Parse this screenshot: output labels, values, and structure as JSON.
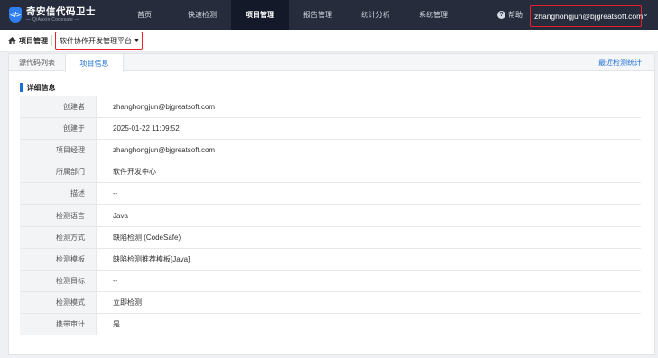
{
  "logo": {
    "main": "奇安信代码卫士",
    "sub": "— QiAnxin Codesafe —",
    "glyph": "</>"
  },
  "nav": {
    "items": [
      {
        "label": "首页"
      },
      {
        "label": "快速检测"
      },
      {
        "label": "项目管理",
        "active": true
      },
      {
        "label": "报告管理"
      },
      {
        "label": "统计分析"
      },
      {
        "label": "系统管理"
      }
    ],
    "help": "帮助",
    "user": "zhanghongjun@bjgreatsoft.com"
  },
  "breadcrumb": {
    "title": "项目管理",
    "project": "软件协作开发管理平台"
  },
  "tabs": [
    {
      "label": "源代码列表"
    },
    {
      "label": "项目信息",
      "active": true
    }
  ],
  "recent_link": "最近检测统计",
  "section_title": "详细信息",
  "details": [
    {
      "label": "创建者",
      "value": "zhanghongjun@bjgreatsoft.com"
    },
    {
      "label": "创建于",
      "value": "2025-01-22 11:09:52"
    },
    {
      "label": "项目经理",
      "value": "zhanghongjun@bjgreatsoft.com"
    },
    {
      "label": "所属部门",
      "value": "软件开发中心"
    },
    {
      "label": "描述",
      "value": "--"
    },
    {
      "label": "检测语言",
      "value": "Java"
    },
    {
      "label": "检测方式",
      "value": "缺陷检测 (CodeSafe)"
    },
    {
      "label": "检测模板",
      "value": "缺陷检测推荐模板[Java]"
    },
    {
      "label": "检测目标",
      "value": "--"
    },
    {
      "label": "检测模式",
      "value": "立即检测"
    },
    {
      "label": "携带审计",
      "value": "是"
    }
  ],
  "colors": {
    "topbar": "#262c3c",
    "accent": "#1d6fd6",
    "highlight": "#e8202a"
  }
}
